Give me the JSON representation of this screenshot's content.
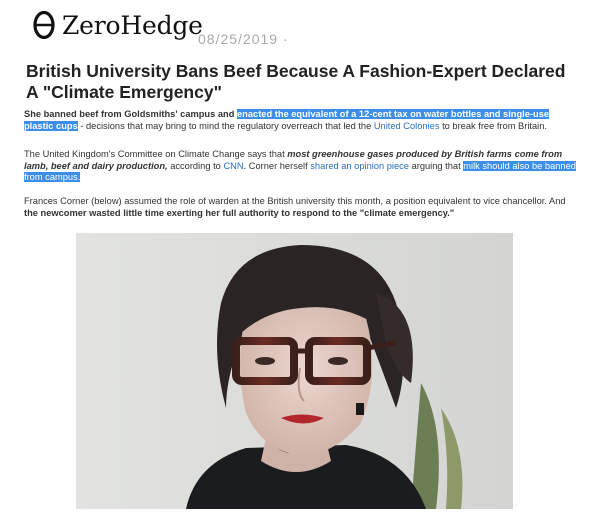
{
  "header": {
    "logo_text": "ZeroHedge",
    "date": "08/25/2019 ·"
  },
  "article": {
    "title": "British University Bans Beef Because A Fashion-Expert Declared A \"Climate Emergency\"",
    "p1": {
      "s1": "She banned beef from Goldsmiths' campus and",
      "s2": "enacted the equivalent of a 12-cent tax on water bottles and single-use plastic cups",
      "s3": " - decisions that may bring to mind the regulatory overreach that led the ",
      "link": "United Colonies",
      "s4": " to break free from Britain."
    },
    "p2": {
      "s1": "The United Kingdom's Committee on Climate Change says that ",
      "s2": "most greenhouse gases produced by British farms come from lamb, beef and dairy production,",
      "s3": " according to ",
      "link1": "CNN",
      "s4": ". Corner herself ",
      "link2": "shared an opinion piece",
      "s5": " arguing that ",
      "s6": "milk should also be banned from campus."
    },
    "p3": {
      "s1": "Frances Corner (below) assumed the role of warden at the British university this month, a position equivalent to vice chancellor. And ",
      "s2": "the newcomer wasted little time exerting her full authority to respond to the \"climate emergency.\""
    }
  },
  "colors": {
    "highlight": "#3d8ee8",
    "link": "#2b6fbb",
    "date": "#a9a9a9"
  },
  "icons": {
    "logo_mark": "theta-logo-icon"
  }
}
